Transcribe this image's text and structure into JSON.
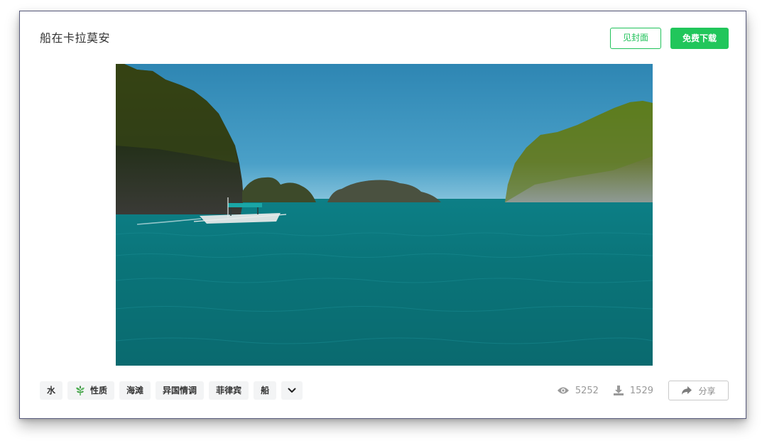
{
  "card": {
    "title": "船在卡拉莫安",
    "buttons": {
      "view_cover": "见封面",
      "free_download": "免费下载"
    }
  },
  "tags": [
    {
      "label": "水",
      "icon": null
    },
    {
      "label": "性质",
      "icon": "leaf-icon"
    },
    {
      "label": "海滩",
      "icon": null
    },
    {
      "label": "异国情调",
      "icon": null
    },
    {
      "label": "菲律宾",
      "icon": null
    },
    {
      "label": "船",
      "icon": null
    }
  ],
  "stats": {
    "views": "5252",
    "downloads": "1529"
  },
  "share": {
    "label": "分享"
  },
  "colors": {
    "accent": "#21c65b",
    "card_border": "#56597a",
    "tag_bg": "#f3f4f5",
    "muted": "#9a9a9a"
  }
}
